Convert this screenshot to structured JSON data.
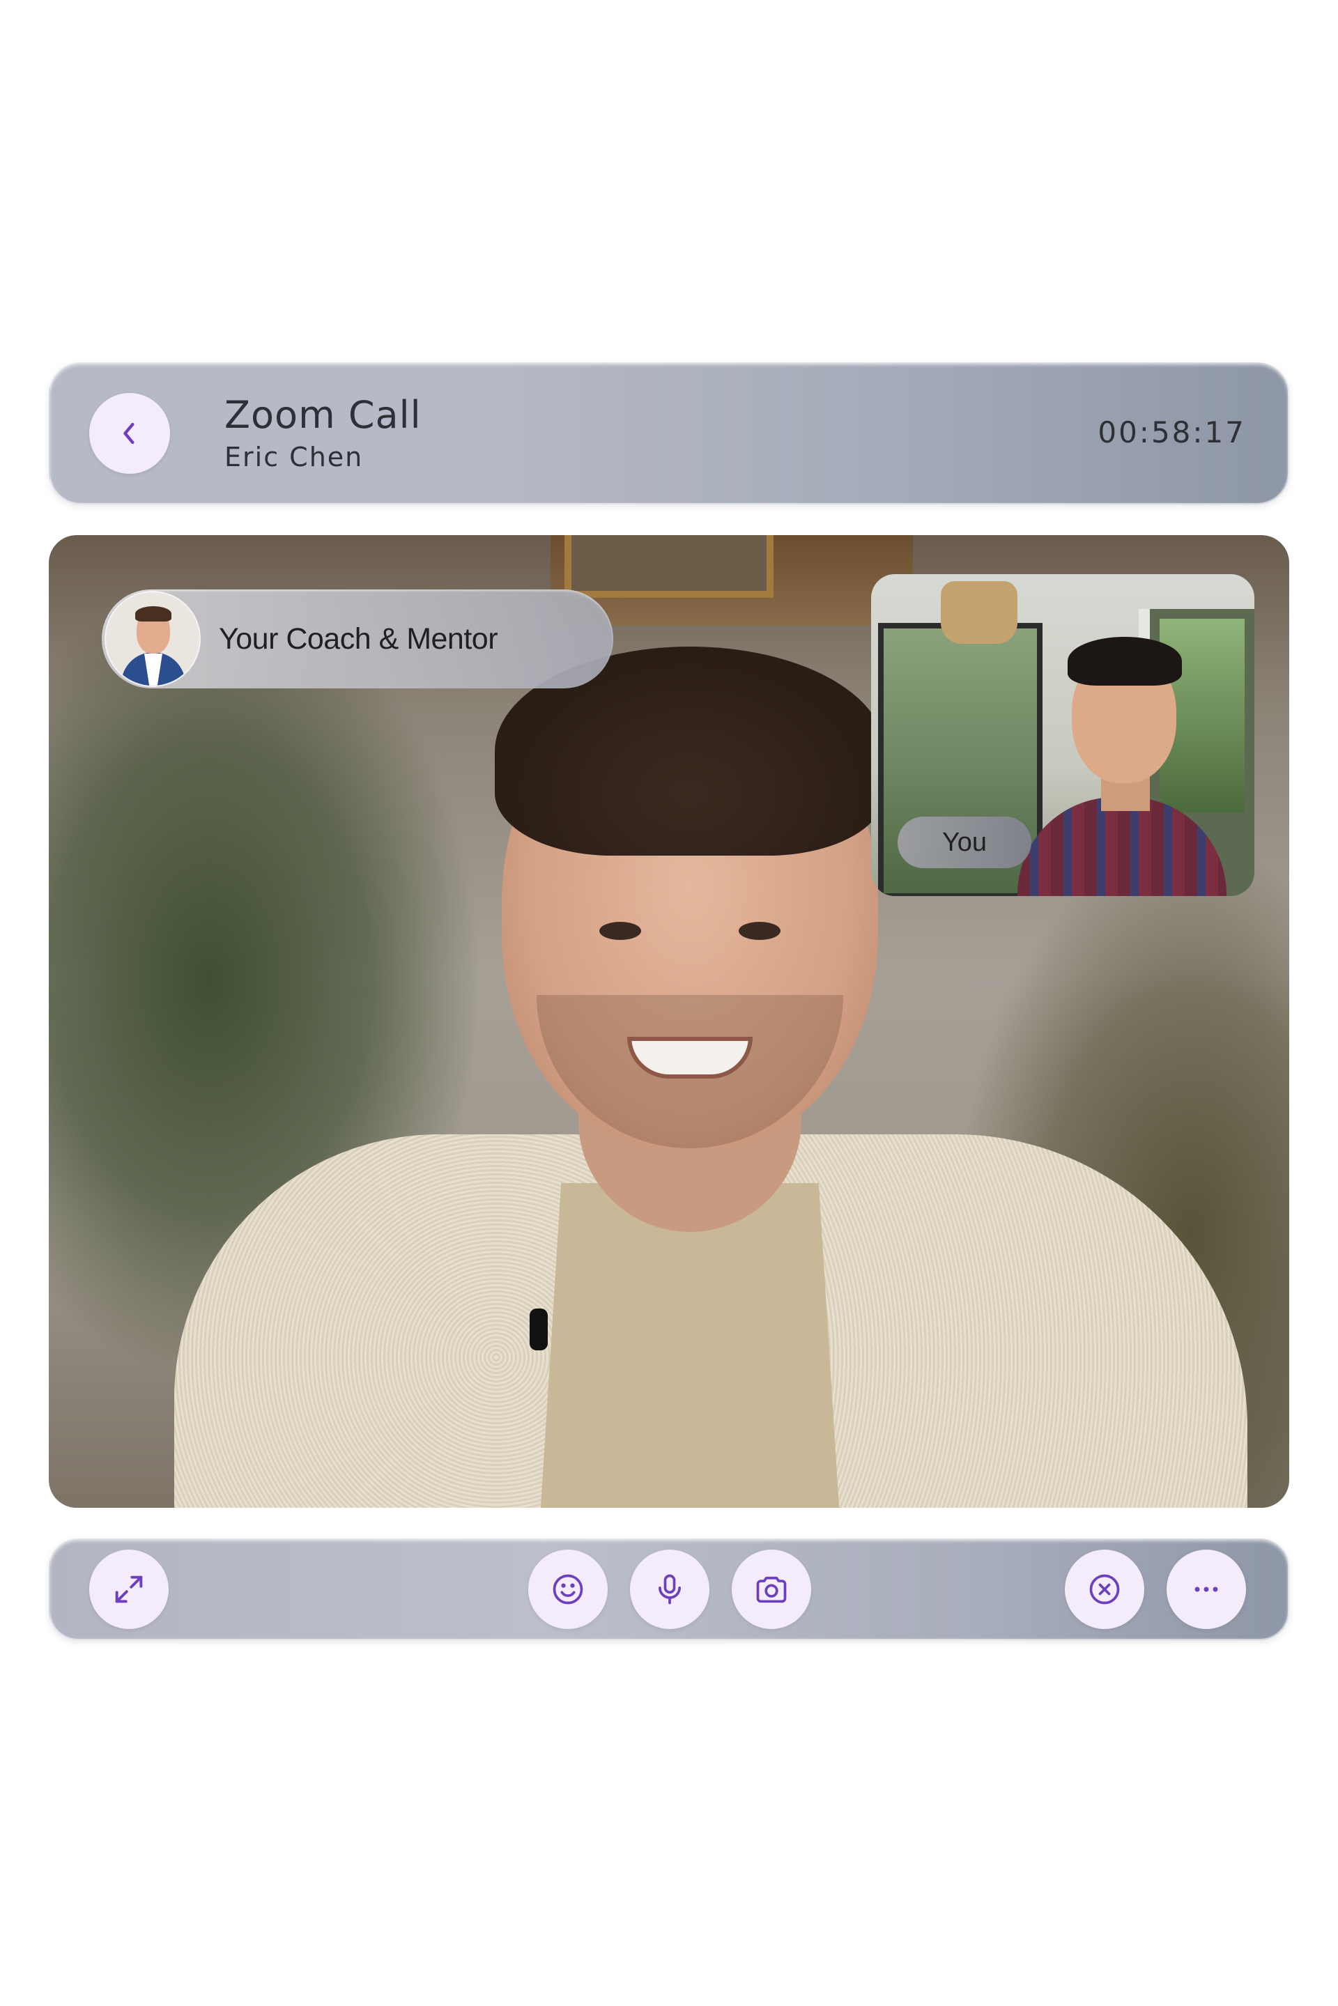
{
  "header": {
    "title": "Zoom Call",
    "subtitle": "Eric Chen",
    "timer": "00:58:17",
    "back_icon": "chevron-left-icon"
  },
  "video": {
    "coach_label": "Your Coach & Mentor",
    "self_label": "You"
  },
  "controls": {
    "left": [
      {
        "icon": "expand-icon"
      }
    ],
    "center": [
      {
        "icon": "emoji-icon"
      },
      {
        "icon": "microphone-icon"
      },
      {
        "icon": "camera-icon"
      }
    ],
    "right": [
      {
        "icon": "close-circle-icon"
      },
      {
        "icon": "more-horizontal-icon"
      }
    ]
  },
  "colors": {
    "accent": "#6c3fbf",
    "button_bg": "#f4ecfb",
    "text": "#2f3037"
  }
}
